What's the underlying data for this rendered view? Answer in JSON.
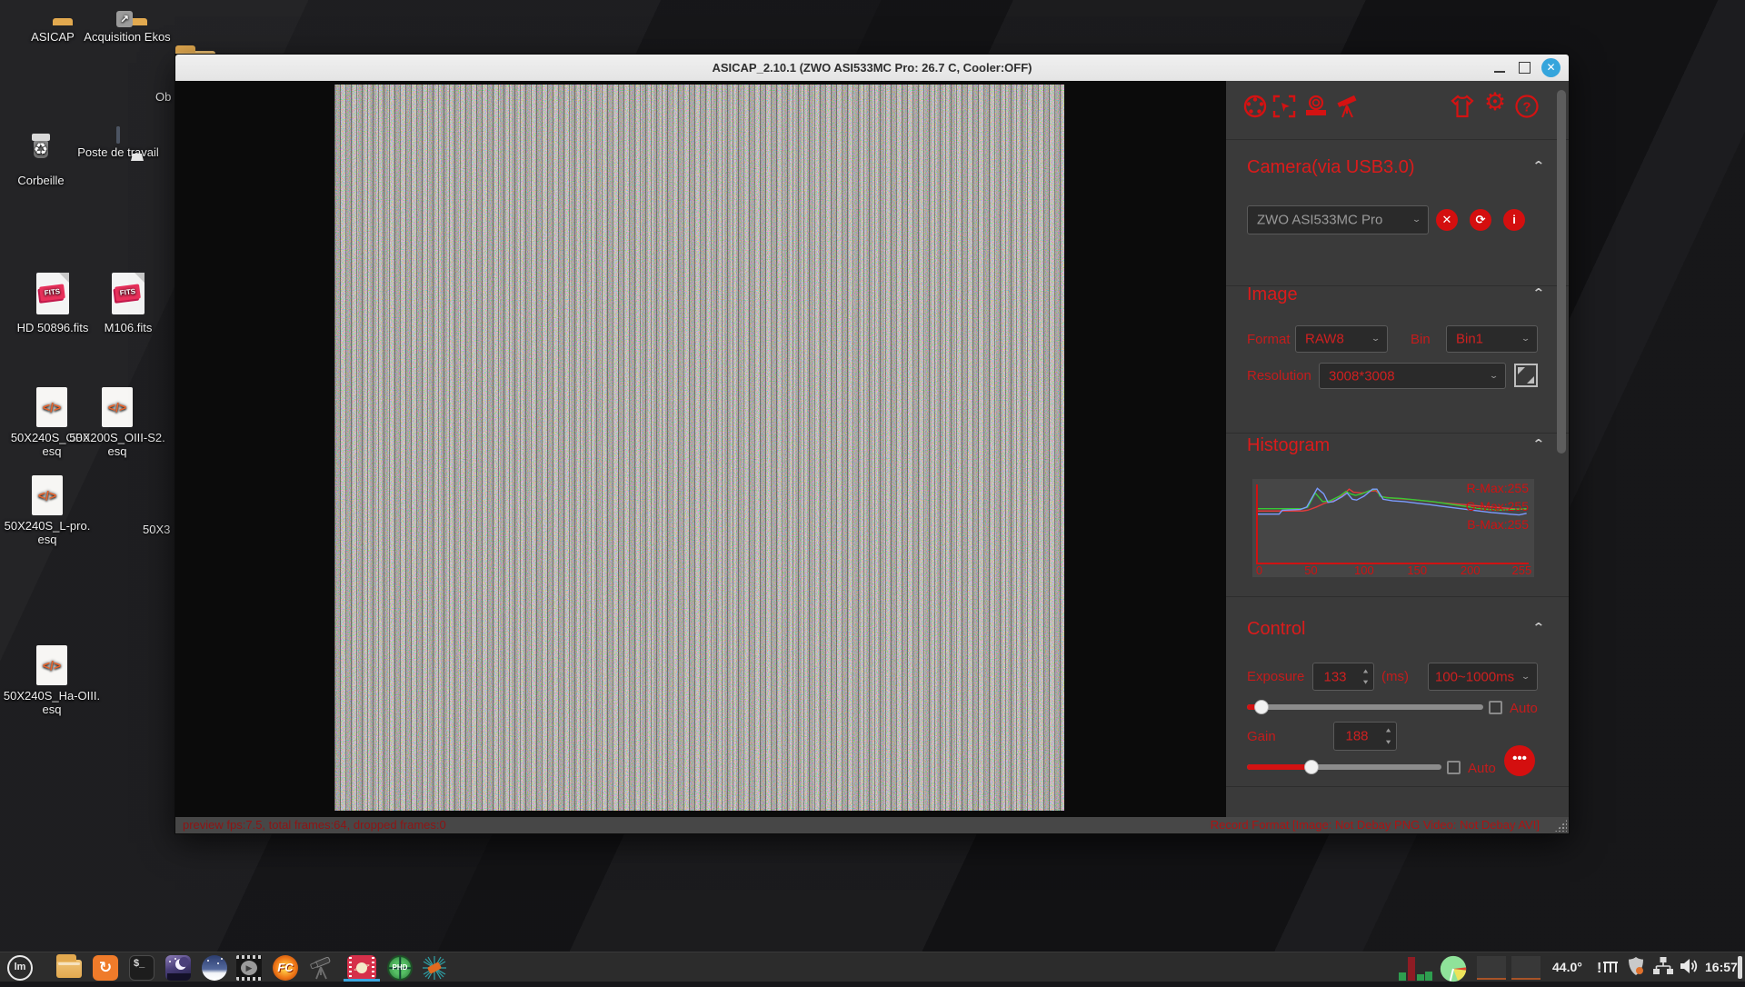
{
  "window": {
    "title": "ASICAP_2.10.1 (ZWO ASI533MC Pro: 26.7 C, Cooler:OFF)",
    "status_left": "preview fps:7.5, total frames:64, dropped frames:0",
    "status_right": "Record Format [Image: Not Debay PNG Video: Not Debay AVI]"
  },
  "panel": {
    "camera": {
      "title": "Camera(via USB3.0)",
      "device": "ZWO ASI533MC Pro"
    },
    "image": {
      "title": "Image",
      "format_label": "Format",
      "format_value": "RAW8",
      "bin_label": "Bin",
      "bin_value": "Bin1",
      "resolution_label": "Resolution",
      "resolution_value": "3008*3008"
    },
    "histogram": {
      "title": "Histogram",
      "legend": {
        "r": "R-Max:255",
        "g": "G-Max:255",
        "b": "B-Max:255"
      },
      "x_ticks": [
        "0",
        "50",
        "100",
        "150",
        "200",
        "255"
      ],
      "x_max": 255,
      "colors": {
        "r": "#e23b3b",
        "g": "#35c935",
        "b": "#7b9bff"
      },
      "curves": {
        "b": [
          [
            0,
            38
          ],
          [
            20,
            38
          ],
          [
            23,
            33
          ],
          [
            40,
            32
          ],
          [
            46,
            29
          ],
          [
            56,
            5
          ],
          [
            62,
            12
          ],
          [
            66,
            23
          ],
          [
            71,
            22
          ],
          [
            79,
            16
          ],
          [
            84,
            11
          ],
          [
            89,
            19
          ],
          [
            93,
            20
          ],
          [
            100,
            15
          ],
          [
            108,
            6
          ],
          [
            112,
            6
          ],
          [
            118,
            19
          ],
          [
            127,
            21
          ],
          [
            138,
            22
          ],
          [
            150,
            24
          ],
          [
            162,
            26
          ],
          [
            173,
            28
          ],
          [
            185,
            30
          ],
          [
            197,
            32
          ],
          [
            208,
            34
          ],
          [
            220,
            36
          ],
          [
            229,
            37
          ],
          [
            237,
            38
          ],
          [
            246,
            39
          ],
          [
            253,
            37
          ]
        ],
        "g": [
          [
            0,
            31
          ],
          [
            42,
            31
          ],
          [
            47,
            29
          ],
          [
            54,
            11
          ],
          [
            61,
            22
          ],
          [
            68,
            21
          ],
          [
            77,
            15
          ],
          [
            83,
            9
          ],
          [
            87,
            12
          ],
          [
            92,
            14
          ],
          [
            98,
            12
          ],
          [
            105,
            8
          ],
          [
            112,
            6
          ],
          [
            115,
            15
          ],
          [
            121,
            17
          ],
          [
            135,
            18
          ],
          [
            150,
            20
          ],
          [
            165,
            22
          ],
          [
            180,
            25
          ],
          [
            195,
            28
          ],
          [
            210,
            31
          ],
          [
            225,
            33
          ],
          [
            240,
            32
          ],
          [
            253,
            31
          ]
        ],
        "r": [
          [
            0,
            34
          ],
          [
            42,
            34
          ],
          [
            47,
            33
          ],
          [
            55,
            29
          ],
          [
            63,
            24
          ],
          [
            74,
            20
          ],
          [
            82,
            11
          ],
          [
            86,
            6
          ],
          [
            90,
            10
          ],
          [
            98,
            11
          ],
          [
            105,
            9
          ],
          [
            111,
            8
          ],
          [
            117,
            16
          ],
          [
            130,
            18
          ],
          [
            150,
            20
          ],
          [
            170,
            23
          ],
          [
            195,
            26
          ],
          [
            220,
            29
          ],
          [
            240,
            31
          ],
          [
            253,
            32
          ]
        ]
      }
    },
    "control": {
      "title": "Control",
      "exposure_label": "Exposure",
      "exposure_value": "133",
      "exposure_unit": "(ms)",
      "exposure_range": "100~1000ms",
      "exposure_slider_pct": "6",
      "gain_label": "Gain",
      "gain_value": "188",
      "gain_slider_pct": "33",
      "auto_label": "Auto",
      "more_label": "•••"
    }
  },
  "desktop": {
    "fits_badge": "FITS",
    "esq_glyph": "</>",
    "icons": [
      {
        "label": "ASICAP"
      },
      {
        "label": "Acquisition Ekos"
      },
      {
        "label": "Corbeille"
      },
      {
        "label": "Poste de travail"
      },
      {
        "label": "HD 50896.fits"
      },
      {
        "label": "M106.fits"
      },
      {
        "label": "50X240S_OB0.",
        "label2": "esq"
      },
      {
        "label": "50X200S_OIII-S2.",
        "label2": "esq"
      },
      {
        "label": "50X240S_L-pro.",
        "label2": "esq"
      },
      {
        "label": "50X240S_Ha-OIII.",
        "label2": "esq"
      }
    ],
    "partial_labels": {
      "ob": "Ob",
      "x3": "50X3"
    }
  },
  "taskbar": {
    "mint": "lm",
    "terminal": "$_",
    "firecapture": "FC",
    "phd": "PHD",
    "temperature": "44.0°",
    "time": "16:57",
    "update_glyph": "↻",
    "recycle_glyph": "♻",
    "play_glyph": "▶"
  }
}
